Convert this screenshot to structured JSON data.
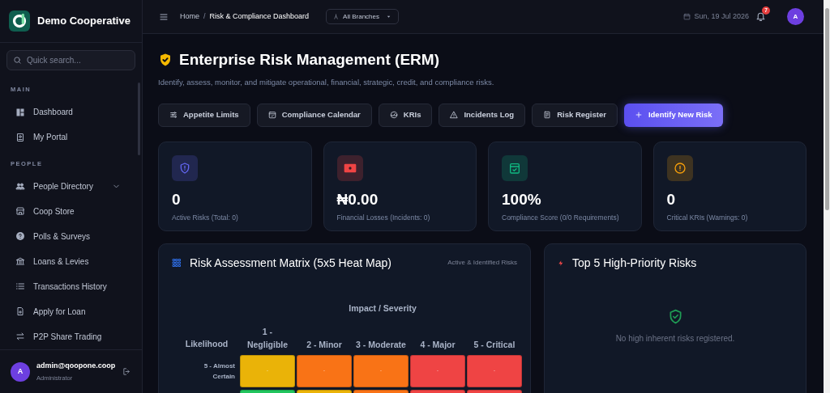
{
  "sidebar": {
    "brand": "Demo Cooperative",
    "search": {
      "placeholder": "Quick search..."
    },
    "sections": [
      {
        "title": "MAIN",
        "items": [
          {
            "label": "Dashboard",
            "kind": "link"
          },
          {
            "label": "My Portal",
            "kind": "link"
          }
        ]
      },
      {
        "title": "PEOPLE",
        "items": [
          {
            "label": "People Directory",
            "kind": "group"
          },
          {
            "label": "Coop Store",
            "kind": "link"
          },
          {
            "label": "Polls & Surveys",
            "kind": "link"
          },
          {
            "label": "Loans & Levies",
            "kind": "link"
          },
          {
            "label": "Transactions History",
            "kind": "link"
          },
          {
            "label": "Apply for Loan",
            "kind": "link"
          },
          {
            "label": "P2P Share Trading",
            "kind": "link"
          }
        ]
      }
    ],
    "user": {
      "avatar": "A",
      "email": "admin@qoopone.coop",
      "role": "Administrator"
    }
  },
  "topbar": {
    "breadcrumb": [
      "Home",
      "Risk & Compliance Dashboard"
    ],
    "separator": "/",
    "branch": "All Branches",
    "date": "Sun, 19 Jul 2026",
    "notifications": "7",
    "avatar": "A"
  },
  "header": {
    "title": "Enterprise Risk Management (ERM)",
    "subtitle": "Identify, assess, monitor, and mitigate operational, financial, strategic, credit, and compliance risks."
  },
  "actions": [
    {
      "label": "Appetite Limits",
      "kind": "secondary"
    },
    {
      "label": "Compliance Calendar",
      "kind": "secondary"
    },
    {
      "label": "KRIs",
      "kind": "secondary"
    },
    {
      "label": "Incidents Log",
      "kind": "secondary"
    },
    {
      "label": "Risk Register",
      "kind": "secondary"
    },
    {
      "label": "Identify New Risk",
      "kind": "primary"
    }
  ],
  "stats": [
    {
      "value": "0",
      "label": "Active Risks (Total: 0)",
      "color": "#6366f1"
    },
    {
      "value": "₦0.00",
      "label": "Financial Losses (Incidents: 0)",
      "color": "#ef4444"
    },
    {
      "value": "100%",
      "label": "Compliance Score (0/0 Requirements)",
      "color": "#10b981"
    },
    {
      "value": "0",
      "label": "Critical KRIs (Warnings: 0)",
      "color": "#f59e0b"
    }
  ],
  "matrix": {
    "title": "Risk Assessment Matrix (5x5 Heat Map)",
    "note": "Active & Identified Risks",
    "axis": "Impact / Severity",
    "corner": "Likelihood",
    "columns": [
      "1 - Negligible",
      "2 - Minor",
      "3 - Moderate",
      "4 - Major",
      "5 - Critical"
    ],
    "rows": [
      {
        "label": "5 - Almost Certain",
        "cells": [
          {
            "color": "#eab308",
            "text": "-"
          },
          {
            "color": "#f97316",
            "text": "-"
          },
          {
            "color": "#f97316",
            "text": "-"
          },
          {
            "color": "#ef4444",
            "text": "-"
          },
          {
            "color": "#ef4444",
            "text": "-"
          }
        ]
      },
      {
        "cells": [
          {
            "color": "#22c55e"
          },
          {
            "color": "#eab308"
          },
          {
            "color": "#f97316"
          },
          {
            "color": "#ef4444"
          },
          {
            "color": "#ef4444"
          }
        ]
      }
    ]
  },
  "top_risks": {
    "title": "Top 5 High-Priority Risks",
    "empty": "No high inherent risks registered."
  }
}
